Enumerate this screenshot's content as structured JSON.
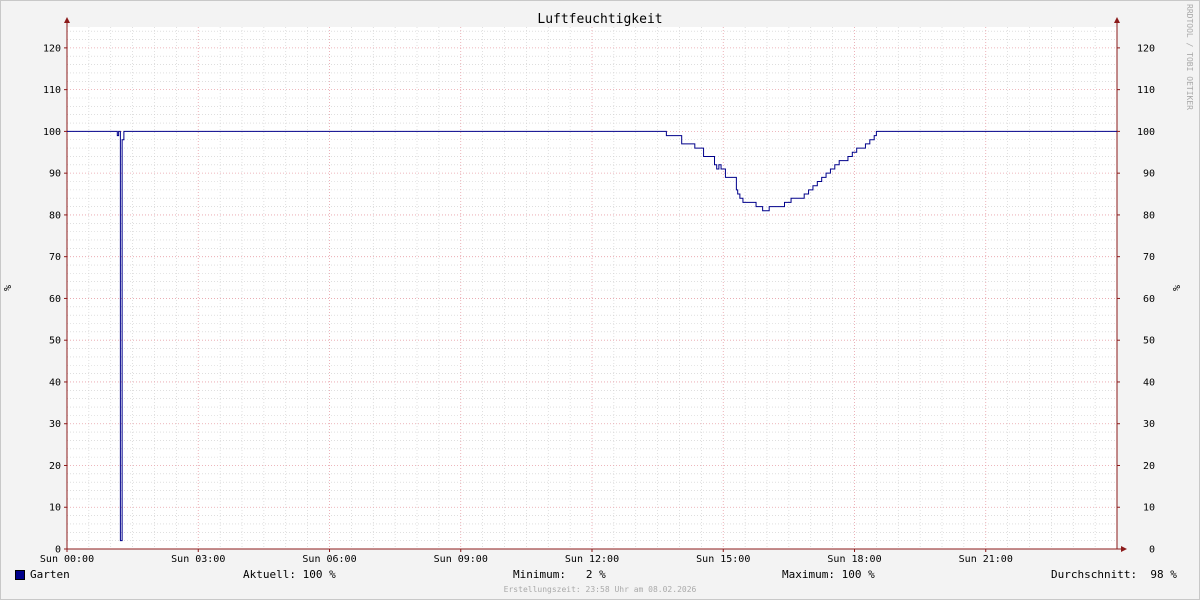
{
  "colors": {
    "background": "#f3f3f3",
    "plot_background": "#ffffff",
    "series": "#00008b",
    "minor_grid": "#cccccc",
    "major_grid": "#e8a0a8",
    "axis": "#8b1a1a"
  },
  "watermark": "RRDTOOL / TOBI OETIKER",
  "legend": {
    "swatch_color": "#00008b",
    "series_name": "Garten",
    "current_label": "Aktuell:",
    "current_value": "100 %",
    "minimum_label": "Minimum:",
    "minimum_value": "  2 %",
    "maximum_label": "Maximum:",
    "maximum_value": "100 %",
    "average_label": "Durchschnitt:",
    "average_value": " 98 %"
  },
  "credits": "Erstellungszeit: 23:58 Uhr am 08.02.2026",
  "chart_data": {
    "type": "line",
    "title": "Luftfeuchtigkeit",
    "ylabel": "%",
    "ylabel_right": "%",
    "xlabel": "",
    "ylim": [
      0,
      125
    ],
    "xlim": [
      0,
      24
    ],
    "yticks": [
      "0",
      "10",
      "20",
      "30",
      "40",
      "50",
      "60",
      "70",
      "80",
      "90",
      "100",
      "110",
      "120"
    ],
    "xticks": [
      "Sun 00:00",
      "Sun 03:00",
      "Sun 06:00",
      "Sun 09:00",
      "Sun 12:00",
      "Sun 15:00",
      "Sun 18:00",
      "Sun 21:00"
    ],
    "grid": true,
    "legend_position": "bottom",
    "series": [
      {
        "name": "Garten",
        "x": [
          0,
          1.12,
          1.15,
          1.18,
          1.22,
          1.26,
          1.3,
          1.35,
          13.65,
          13.7,
          13.9,
          14.05,
          14.3,
          14.35,
          14.55,
          14.75,
          14.8,
          14.85,
          14.9,
          14.95,
          15.0,
          15.05,
          15.2,
          15.3,
          15.33,
          15.38,
          15.45,
          15.55,
          15.75,
          15.9,
          16.05,
          16.2,
          16.4,
          16.55,
          16.75,
          16.85,
          16.95,
          17.05,
          17.15,
          17.25,
          17.35,
          17.45,
          17.55,
          17.65,
          17.75,
          17.8,
          17.85,
          17.95,
          18.05,
          18.15,
          18.25,
          18.35,
          18.45,
          18.5,
          18.6,
          19.0,
          21.0,
          24.0
        ],
        "y": [
          100,
          100,
          99,
          100,
          2,
          98,
          100,
          100,
          100,
          99,
          99,
          97,
          97,
          96,
          94,
          94,
          92,
          91,
          92,
          91,
          91,
          89,
          89,
          86,
          85,
          84,
          83,
          83,
          82,
          81,
          82,
          82,
          83,
          84,
          84,
          85,
          86,
          87,
          88,
          89,
          90,
          91,
          92,
          93,
          93,
          93,
          94,
          95,
          96,
          96,
          97,
          98,
          99,
          100,
          100,
          100,
          100,
          100
        ]
      }
    ]
  }
}
